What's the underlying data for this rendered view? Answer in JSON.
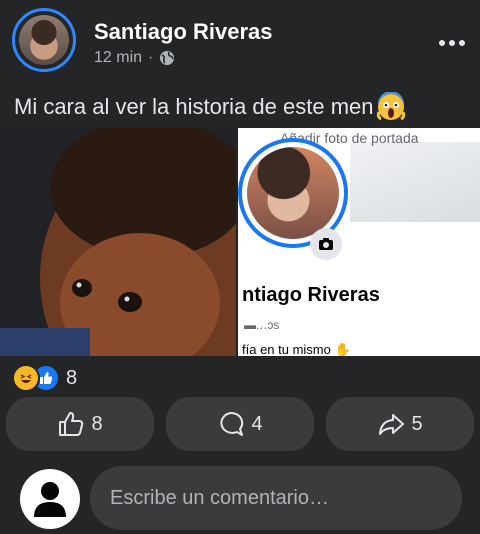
{
  "post": {
    "author_name": "Santiago Riveras",
    "time": "12 min",
    "separator": "·",
    "more_icon": "more-horizontal-icon",
    "caption": "Mi cara al ver la historia de este men",
    "caption_emoji": "face-screaming-in-fear"
  },
  "media": {
    "left_image": "child-reaction-photo",
    "right_image": {
      "cover_text": "Añadir foto de portada",
      "profile_name": "ntiago Riveras",
      "friends_text": "▬.‥ɔs",
      "bio": "fía en tu mismo"
    }
  },
  "reactions": {
    "icons": [
      "haha-icon",
      "like-icon"
    ],
    "count": "8"
  },
  "actions": {
    "like_count": "8",
    "comment_count": "4",
    "share_count": "5"
  },
  "comment": {
    "placeholder": "Escribe un comentario…"
  },
  "colors": {
    "background": "#242526",
    "surface": "#3a3b3c",
    "accent": "#2d88ff",
    "text_primary": "#e4e6eb",
    "text_secondary": "#b0b3b8"
  }
}
